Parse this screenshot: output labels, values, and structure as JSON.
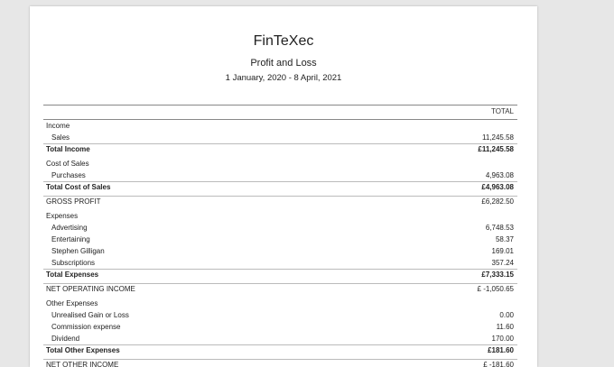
{
  "header": {
    "company": "FinTeXec",
    "report_title": "Profit and Loss",
    "date_range": "1 January, 2020 - 8 April, 2021",
    "column_total": "TOTAL"
  },
  "rows": [
    {
      "label": "Income",
      "amount": "",
      "style": "section"
    },
    {
      "label": "Sales",
      "amount": "11,245.58",
      "style": "indent"
    },
    {
      "label": "Total Income",
      "amount": "£11,245.58",
      "style": "total"
    },
    {
      "label": "Cost of Sales",
      "amount": "",
      "style": "section"
    },
    {
      "label": "Purchases",
      "amount": "4,963.08",
      "style": "indent"
    },
    {
      "label": "Total Cost of Sales",
      "amount": "£4,963.08",
      "style": "total"
    },
    {
      "label": "GROSS PROFIT",
      "amount": "£6,282.50",
      "style": "summary"
    },
    {
      "label": "Expenses",
      "amount": "",
      "style": "section"
    },
    {
      "label": "Advertising",
      "amount": "6,748.53",
      "style": "indent"
    },
    {
      "label": "Entertaining",
      "amount": "58.37",
      "style": "indent"
    },
    {
      "label": "Stephen Gilligan",
      "amount": "169.01",
      "style": "indent"
    },
    {
      "label": "Subscriptions",
      "amount": "357.24",
      "style": "indent"
    },
    {
      "label": "Total Expenses",
      "amount": "£7,333.15",
      "style": "total"
    },
    {
      "label": "NET OPERATING INCOME",
      "amount": "£ -1,050.65",
      "style": "summary"
    },
    {
      "label": "Other Expenses",
      "amount": "",
      "style": "section"
    },
    {
      "label": "Unrealised Gain or Loss",
      "amount": "0.00",
      "style": "indent"
    },
    {
      "label": "Commission expense",
      "amount": "11.60",
      "style": "indent"
    },
    {
      "label": "Dividend",
      "amount": "170.00",
      "style": "indent"
    },
    {
      "label": "Total Other Expenses",
      "amount": "£181.60",
      "style": "total"
    },
    {
      "label": "NET OTHER INCOME",
      "amount": "£ -181.60",
      "style": "summary"
    }
  ]
}
